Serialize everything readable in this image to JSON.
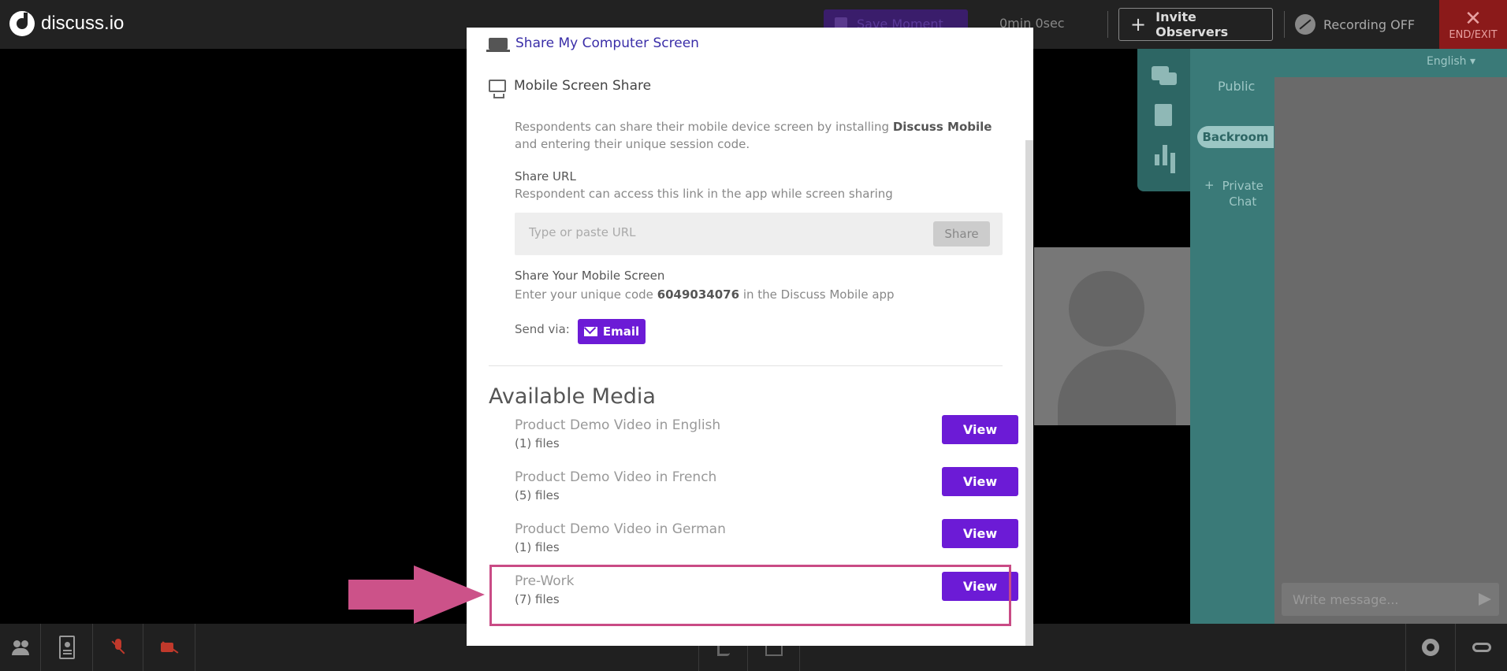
{
  "topbar": {
    "logo_text": "discuss.io",
    "save_moment_label": "Save Moment",
    "timer": "0min 0sec",
    "invite_label": "Invite Observers",
    "recording_label": "Recording OFF",
    "end_exit_label": "END/EXIT"
  },
  "right_panel": {
    "language": "English",
    "tab_public": "Public",
    "tab_backroom": "Backroom",
    "private_chat_line1": "Private",
    "private_chat_line2": "Chat",
    "message_placeholder": "Write message..."
  },
  "modal": {
    "share_computer_label": "Share My Computer Screen",
    "mobile_share_label": "Mobile Screen Share",
    "desc_part1": "Respondents can share their mobile device screen by installing ",
    "desc_bold": "Discuss Mobile",
    "desc_part2": "and entering their unique session code.",
    "share_url_title": "Share URL",
    "share_url_sub": "Respondent can access this link in the app while screen sharing",
    "url_placeholder": "Type or paste URL",
    "url_share_button": "Share",
    "mobile_title": "Share Your Mobile Screen",
    "mobile_sub_prefix": "Enter your unique code ",
    "session_code": "6049034076",
    "mobile_sub_suffix": " in the Discuss Mobile app",
    "send_via_label": "Send via:",
    "email_button": "Email",
    "available_media_title": "Available Media",
    "media": [
      {
        "name": "Product Demo Video in English",
        "count": "(1) files",
        "button": "View"
      },
      {
        "name": "Product Demo Video in French",
        "count": "(5) files",
        "button": "View"
      },
      {
        "name": "Product Demo Video in German",
        "count": "(1) files",
        "button": "View"
      },
      {
        "name": "Pre-Work",
        "count": "(7) files",
        "button": "View"
      }
    ]
  },
  "colors": {
    "accent_purple": "#6c1bd6",
    "highlight_pink": "#c94b85",
    "panel_teal": "#3a7a78",
    "end_red": "#8b1a1a"
  }
}
